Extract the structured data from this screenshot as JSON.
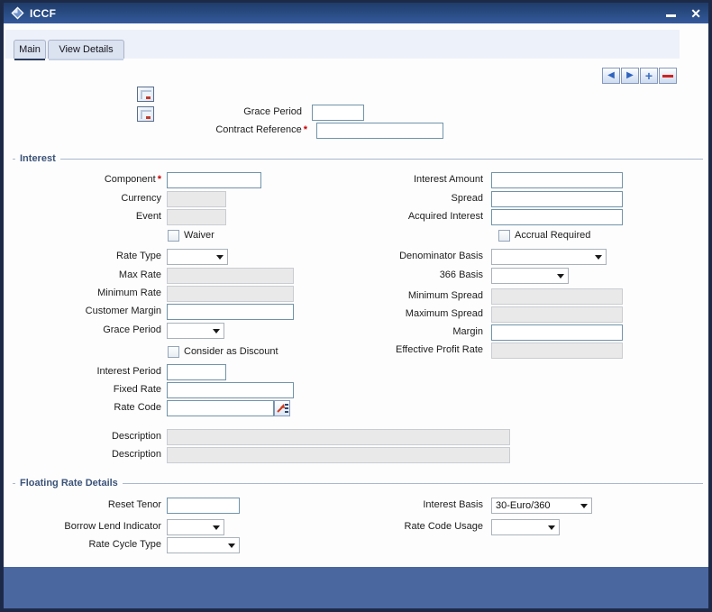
{
  "window": {
    "title": "ICCF",
    "close_glyph": "✕"
  },
  "tabs": {
    "main": "Main",
    "view_details": "View Details"
  },
  "toolbar": {
    "prev_glyph": "◀",
    "next_glyph": "▶",
    "add_glyph": "+"
  },
  "required_marker": "*",
  "top": {
    "grace_period_label": "Grace Period",
    "contract_reference_label": "Contract Reference"
  },
  "interest": {
    "title": "Interest",
    "component_label": "Component",
    "currency_label": "Currency",
    "event_label": "Event",
    "waiver_label": "Waiver",
    "rate_type_label": "Rate Type",
    "max_rate_label": "Max Rate",
    "minimum_rate_label": "Minimum Rate",
    "customer_margin_label": "Customer Margin",
    "grace_period_label": "Grace Period",
    "consider_as_discount_label": "Consider as Discount",
    "interest_period_label": "Interest Period",
    "fixed_rate_label": "Fixed Rate",
    "rate_code_label": "Rate Code",
    "description1_label": "Description",
    "description2_label": "Description",
    "interest_amount_label": "Interest Amount",
    "spread_label": "Spread",
    "acquired_interest_label": "Acquired Interest",
    "accrual_required_label": "Accrual Required",
    "denominator_basis_label": "Denominator Basis",
    "basis366_label": "366 Basis",
    "minimum_spread_label": "Minimum Spread",
    "maximum_spread_label": "Maximum Spread",
    "margin_label": "Margin",
    "effective_profit_rate_label": "Effective Profit Rate"
  },
  "floating": {
    "title": "Floating Rate Details",
    "reset_tenor_label": "Reset Tenor",
    "borrow_lend_indicator_label": "Borrow Lend Indicator",
    "rate_cycle_type_label": "Rate Cycle Type",
    "interest_basis_label": "Interest Basis",
    "interest_basis_value": "30-Euro/360",
    "rate_code_usage_label": "Rate Code Usage"
  },
  "colors": {
    "titlebar_top": "#1f3b6a",
    "titlebar_bottom": "#34599c",
    "footer": "#4a67a0",
    "required_red": "#cc0000",
    "section_title": "#3b5378"
  }
}
